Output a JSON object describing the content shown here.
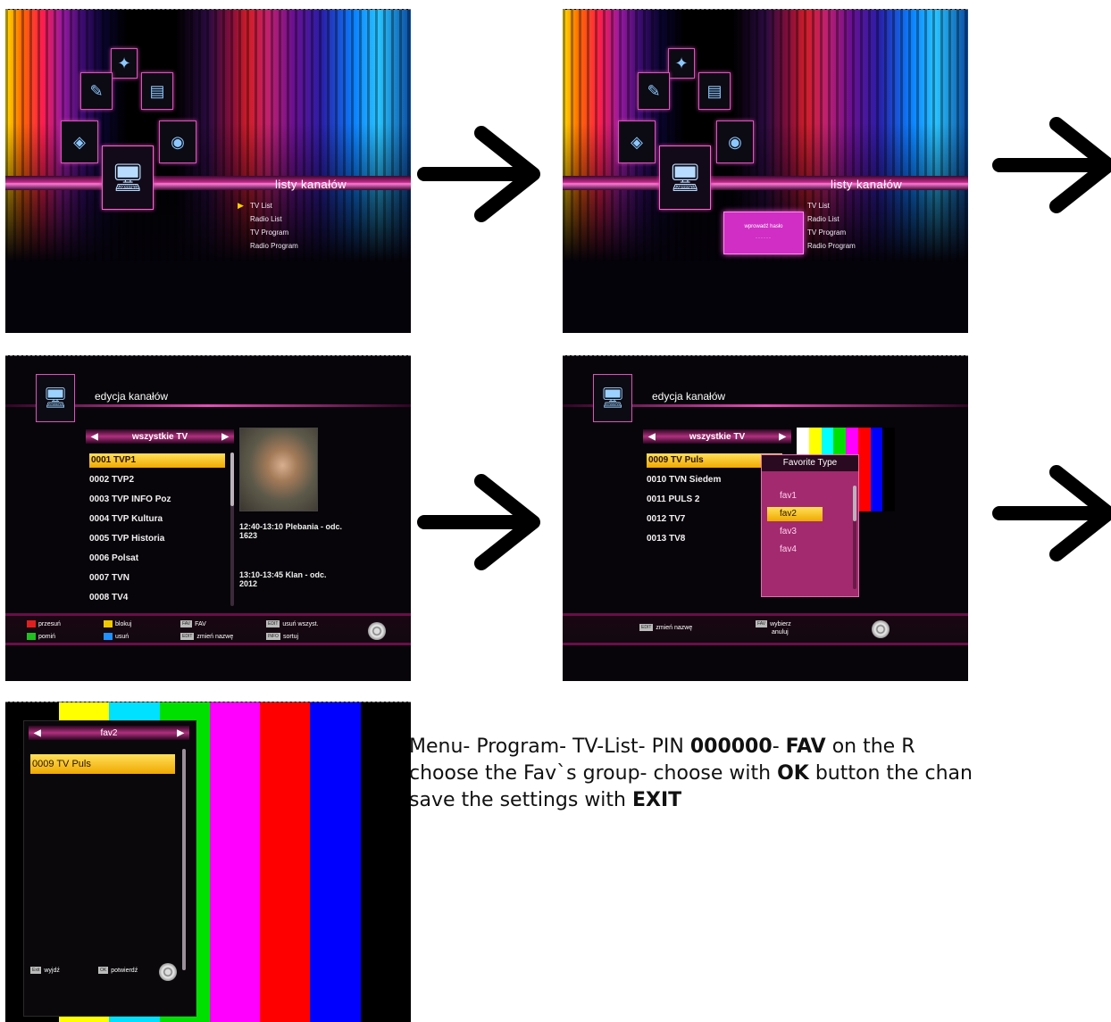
{
  "colors": {
    "pink_accent": "#e64fb8",
    "highlight_yellow": "#f0a800",
    "popup_magenta": "#a32a6e",
    "pin_box": "#d02ec4"
  },
  "screen1": {
    "menu_title": "listy kanałów",
    "menu_items": [
      "TV List",
      "Radio List",
      "TV Program",
      "Radio Program"
    ],
    "selected_index": 0,
    "icons": [
      "satellite-icon",
      "tv-tools-icon",
      "printer-icon",
      "media-icon",
      "globe-icon",
      "monitor-icon"
    ]
  },
  "screen2": {
    "menu_title": "listy kanałów",
    "menu_items": [
      "TV List",
      "Radio List",
      "TV Program",
      "Radio Program"
    ],
    "pin_prompt": "wprowadź hasło",
    "pin_mask": "······"
  },
  "screen3": {
    "title": "edycja kanałów",
    "group": "wszystkie TV",
    "channels": [
      "0001 TVP1",
      "0002 TVP2",
      "0003 TVP INFO Poz",
      "0004 TVP Kultura",
      "0005 TVP Historia",
      "0006 Polsat",
      "0007 TVN",
      "0008 TV4"
    ],
    "selected_index": 0,
    "epg": [
      "12:40-13:10 Plebania - odc. 1623",
      "13:10-13:45 Klan - odc. 2012"
    ],
    "footer_keys": [
      {
        "color": "#e02020",
        "label": "przesuń"
      },
      {
        "color": "#f0c800",
        "label": "blokuj"
      },
      {
        "tag": "FAV",
        "label": "FAV"
      },
      {
        "tag": "EDIT",
        "label": "usuń wszyst."
      },
      {
        "color": "#20c020",
        "label": "pomiń"
      },
      {
        "color": "#2090ff",
        "label": "usuń"
      },
      {
        "tag": "EDIT",
        "label": "zmień nazwę"
      },
      {
        "tag": "INFO",
        "label": "sortuj"
      }
    ]
  },
  "screen4": {
    "title": "edycja kanałów",
    "group": "wszystkie TV",
    "channels": [
      "0009 TV Puls",
      "0010 TVN Siedem",
      "0011 PULS 2",
      "0012 TV7",
      "0013 TV8"
    ],
    "selected_index": 0,
    "popup_title": "Favorite Type",
    "fav_options": [
      "fav1",
      "fav2",
      "fav3",
      "fav4"
    ],
    "fav_selected_index": 1,
    "footer_keys": [
      {
        "tag": "EDIT",
        "label": "zmień nazwę"
      },
      {
        "tag": "FAV",
        "label": "wybierz"
      },
      {
        "tag": "",
        "label": "anuluj"
      }
    ]
  },
  "screen5": {
    "group": "fav2",
    "channels": [
      "0009 TV Puls"
    ],
    "footer_keys": [
      {
        "tag": "Exit",
        "label": "wyjdź"
      },
      {
        "tag": "OK",
        "label": "potwierdź"
      }
    ],
    "bar_colors": [
      "#ffff00",
      "#00e0ff",
      "#00e000",
      "#ff00ff",
      "#ff0000",
      "#0000ff",
      "#000000"
    ]
  },
  "instructions": {
    "line1_pre": "Menu- Program- TV-List- PIN ",
    "pin": "000000",
    "line1_mid": "- ",
    "fav": "FAV",
    "line1_post": " on the R",
    "line2_pre": "choose the Fav`s group- choose with ",
    "ok": "OK",
    "line2_post": " button the chan",
    "line3_pre": "save the settings with ",
    "exit": "EXIT"
  }
}
